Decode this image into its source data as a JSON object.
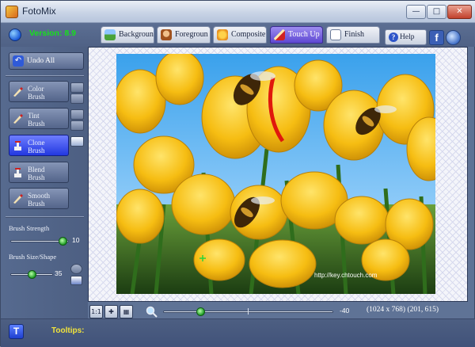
{
  "window": {
    "title": "FotoMix"
  },
  "header": {
    "version": "Version: 8.9",
    "tabs": [
      {
        "label": "Backgroun",
        "state": "normal",
        "icon": "landscape-icon"
      },
      {
        "label": "Foregroun",
        "state": "normal",
        "icon": "person-icon"
      },
      {
        "label": "Composite",
        "state": "normal",
        "icon": "composite-icon"
      },
      {
        "label": "Touch Up",
        "state": "active",
        "icon": "brush-icon"
      },
      {
        "label": "Finish",
        "state": "normal",
        "icon": "document-icon"
      }
    ],
    "help_label": "Help",
    "facebook_label": "f"
  },
  "left_panel": {
    "undo_label": "Undo All",
    "brushes": [
      {
        "line1": "Color",
        "line2": "Brush",
        "active": false
      },
      {
        "line1": "Tint",
        "line2": "Brush",
        "active": false
      },
      {
        "line1": "Clone",
        "line2": "Brush",
        "active": true
      },
      {
        "line1": "Blend",
        "line2": "Brush",
        "active": false
      },
      {
        "line1": "Smooth",
        "line2": "Brush",
        "active": false
      }
    ],
    "brush_strength_label": "Brush Strength",
    "brush_strength_value": "10",
    "brush_strength_level": 0.9,
    "brush_size_label": "Brush Size/Shape",
    "brush_size_value": "35",
    "brush_size_level": 0.5
  },
  "canvas": {
    "watermark": "http://key.chtouch.com"
  },
  "bottom_bar": {
    "fit_label": "1:1",
    "zoom_value": "-40",
    "image_info": "(1024 x 768) (201, 615)"
  },
  "status_bar": {
    "tooltip_button": "T",
    "tooltips_label": "Tooltips:"
  },
  "colors": {
    "accent_active": "#2238e0",
    "version_green": "#16e21a",
    "tooltips_yellow": "#f1e33c",
    "panel_bg": "#566a8f"
  }
}
